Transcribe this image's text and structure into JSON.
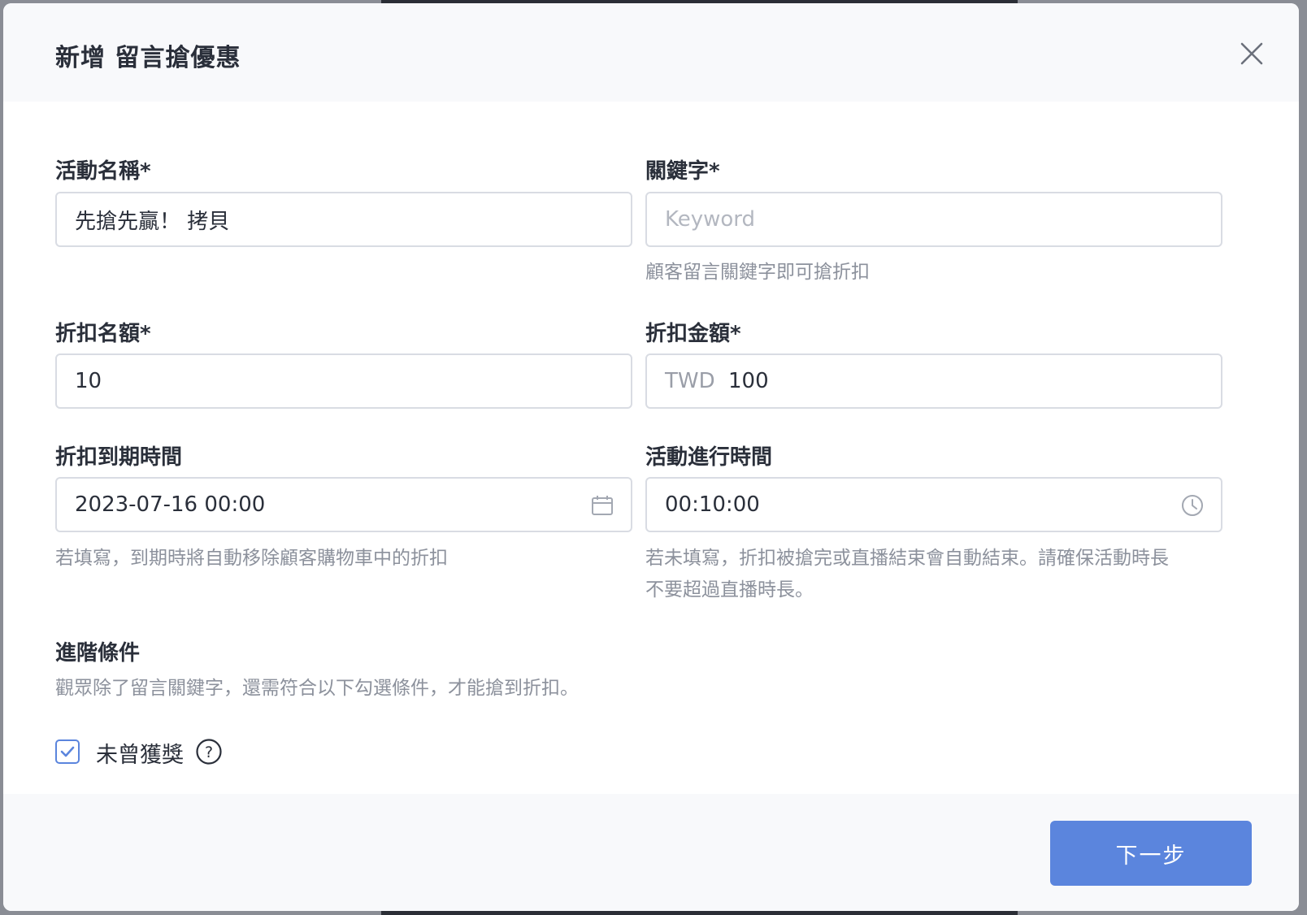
{
  "dialog": {
    "title": "新增 留言搶優惠"
  },
  "fields": {
    "activity_name": {
      "label": "活動名稱*",
      "value": "先搶先贏！ 拷貝"
    },
    "keyword": {
      "label": "關鍵字*",
      "placeholder": "Keyword",
      "helper": "顧客留言關鍵字即可搶折扣"
    },
    "discount_quota": {
      "label": "折扣名額*",
      "value": "10"
    },
    "discount_amount": {
      "label": "折扣金額*",
      "prefix": "TWD",
      "value": "100"
    },
    "expiry_time": {
      "label": "折扣到期時間",
      "value": "2023-07-16 00:00",
      "helper": "若填寫，到期時將自動移除顧客購物車中的折扣"
    },
    "duration": {
      "label": "活動進行時間",
      "value": "00:10:00",
      "helper_line1": "若未填寫，折扣被搶完或直播結束會自動結束。請確保活動時長",
      "helper_line2": "不要超過直播時長。"
    }
  },
  "advanced": {
    "title": "進階條件",
    "description": "觀眾除了留言關鍵字，還需符合以下勾選條件，才能搶到折扣。",
    "never_won_label": "未曾獲獎",
    "never_won_checked": true
  },
  "footer": {
    "next_label": "下一步"
  },
  "colors": {
    "accent": "#5b85dd",
    "text": "#2a2f3a",
    "muted": "#8c919c",
    "border": "#d9dce3"
  },
  "icons": {
    "close": "close-icon",
    "calendar": "calendar-icon",
    "clock": "clock-icon",
    "help": "question-circle-icon",
    "check": "checkmark-icon"
  }
}
